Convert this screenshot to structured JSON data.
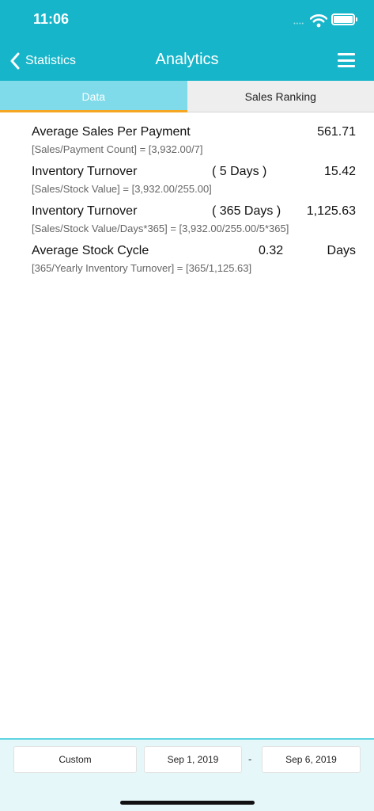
{
  "status_bar": {
    "time": "11:06",
    "signal": "••••"
  },
  "nav": {
    "back_label": "Statistics",
    "title": "Analytics"
  },
  "tabs": [
    {
      "label": "Data",
      "active": true
    },
    {
      "label": "Sales Ranking",
      "active": false
    }
  ],
  "metrics": [
    {
      "name": "Average Sales Per Payment",
      "period": "",
      "value": "561.71",
      "formula": "[Sales/Payment Count] = [3,932.00/7]"
    },
    {
      "name": "Inventory Turnover",
      "period": "( 5 Days )",
      "value": "15.42",
      "formula": "[Sales/Stock Value] = [3,932.00/255.00]"
    },
    {
      "name": "Inventory Turnover",
      "period": "( 365 Days )",
      "value": "1,125.63",
      "formula": "[Sales/Stock Value/Days*365] = [3,932.00/255.00/5*365]"
    },
    {
      "name": "Average Stock Cycle",
      "value": "0.32",
      "unit": "Days",
      "formula": "[365/Yearly Inventory Turnover] = [365/1,125.63]"
    }
  ],
  "footer": {
    "custom_label": "Custom",
    "start_date": "Sep 1, 2019",
    "separator": "-",
    "end_date": "Sep 6, 2019"
  },
  "colors": {
    "header": "#17b5c9",
    "active_tab": "#7fdbe9",
    "tab_indicator": "#f5a623",
    "footer_bg": "#e6f7f9"
  }
}
